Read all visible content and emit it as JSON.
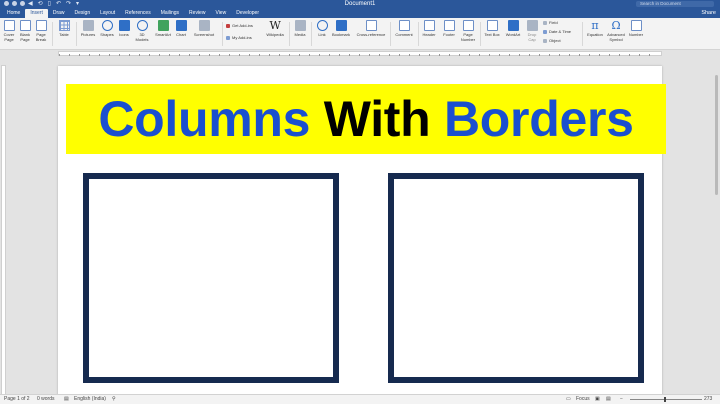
{
  "window": {
    "title": "Document1",
    "search_placeholder": "Search in Document",
    "share_label": "Share",
    "quick_access": [
      "◀",
      "⟲",
      "▯",
      "↶",
      "↷",
      "▾"
    ]
  },
  "tabs": [
    "Home",
    "Insert",
    "Draw",
    "Design",
    "Layout",
    "References",
    "Mailings",
    "Review",
    "View",
    "Developer"
  ],
  "active_tab": "Insert",
  "ribbon": {
    "cover_page": "Cover\nPage",
    "blank_page": "Blank\nPage",
    "page_break": "Page\nBreak",
    "table": "Table",
    "pictures": "Pictures",
    "shapes": "Shapes",
    "icons": "Icons",
    "models_3d": "3D\nModels",
    "smartart": "SmartArt",
    "chart": "Chart",
    "screenshot": "Screenshot",
    "get_addins": "Get Add-ins",
    "my_addins": "My Add-ins",
    "wikipedia": "Wikipedia",
    "media": "Media",
    "link": "Link",
    "bookmark": "Bookmark",
    "cross_reference": "Cross-reference",
    "comment": "Comment",
    "header": "Header",
    "footer": "Footer",
    "page_number": "Page\nNumber",
    "text_box": "Text Box",
    "wordart": "WordArt",
    "drop_cap": "Drop\nCap",
    "field": "Field",
    "date_time": "Date & Time",
    "object": "Object",
    "equation": "Equation",
    "advanced_symbol": "Advanced\nSymbol",
    "number": "Number",
    "wiki_glyph": "W",
    "pi_glyph": "π",
    "omega_glyph": "Ω"
  },
  "document": {
    "heading_words": [
      "Columns",
      "With",
      "Borders"
    ],
    "heading_highlight": "#ffff00",
    "heading_colors": {
      "blue": "#1a4fcf",
      "black": "#000000"
    },
    "box_border_color": "#162a4f"
  },
  "status": {
    "page": "Page 1 of 2",
    "words": "0 words",
    "language": "English (India)",
    "focus": "Focus",
    "zoom": "273"
  }
}
